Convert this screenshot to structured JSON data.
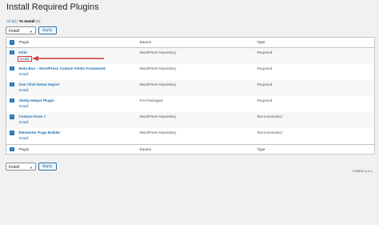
{
  "page": {
    "title": "Install Required Plugins",
    "filters": {
      "all_label": "All",
      "all_count": "(6)",
      "separator": "|",
      "to_install_label": "To Install",
      "to_install_count": "(6)"
    },
    "bulk_action_value": "Install",
    "apply_label": "Apply",
    "version_text": "TGMPA v2.6.1"
  },
  "table": {
    "headers": {
      "plugin": "Plugin",
      "source": "Source",
      "type": "Type"
    },
    "action_label": "Install",
    "rows": [
      {
        "name": "Kirki",
        "source": "WordPress Repository",
        "type": "Required"
      },
      {
        "name": "Meta Box – WordPress Custom Fields Framework",
        "source": "WordPress Repository",
        "type": "Required"
      },
      {
        "name": "One Click Demo Import",
        "source": "WordPress Repository",
        "type": "Required"
      },
      {
        "name": "Shelly Helper Plugin",
        "source": "Pre-Packaged",
        "type": "Required"
      },
      {
        "name": "Contact Form 7",
        "source": "WordPress Repository",
        "type": "Recommended"
      },
      {
        "name": "Elementor Page Builder",
        "source": "WordPress Repository",
        "type": "Recommended"
      }
    ]
  },
  "colors": {
    "link": "#2271b1",
    "annotation": "#d63638",
    "background": "#f1f1f1"
  }
}
